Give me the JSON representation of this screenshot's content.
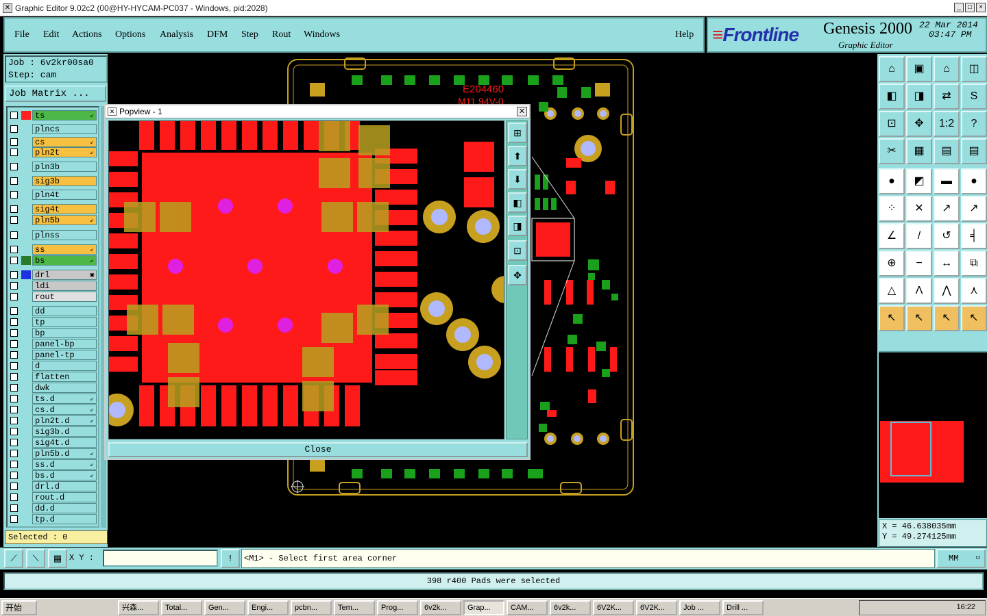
{
  "window": {
    "title": "Graphic Editor 9.02c2 (00@HY-HYCAM-PC037 - Windows, pid:2028)",
    "controls": [
      "_",
      "□",
      "×"
    ]
  },
  "menu": {
    "items": [
      "File",
      "Edit",
      "Actions",
      "Options",
      "Analysis",
      "DFM",
      "Step",
      "Rout",
      "Windows"
    ],
    "help": "Help"
  },
  "brand": {
    "logo": "Frontline",
    "product": "Genesis 2000",
    "subtitle": "Graphic Editor",
    "date": "22  Mar 2014",
    "time": "03:47 PM"
  },
  "job": {
    "job_line": "Job : 6v2kr00sa0",
    "step_line": "Step: cam",
    "matrix_label": "Job Matrix ..."
  },
  "layers": [
    {
      "name": "ts",
      "color": "#ff2020",
      "bg": "#4db848",
      "mark": "⇙"
    },
    {
      "name": "plncs",
      "color": "",
      "bg": "#98dede",
      "mark": ""
    },
    {
      "name": "cs",
      "color": "",
      "bg": "#f8c040",
      "mark": "⇙"
    },
    {
      "name": "pln2t",
      "color": "",
      "bg": "#f8c040",
      "mark": "⇙"
    },
    {
      "name": "pln3b",
      "color": "",
      "bg": "#98dede",
      "mark": ""
    },
    {
      "name": "sig3b",
      "color": "",
      "bg": "#f8c040",
      "mark": ""
    },
    {
      "name": "pln4t",
      "color": "",
      "bg": "#98dede",
      "mark": ""
    },
    {
      "name": "sig4t",
      "color": "",
      "bg": "#f8c040",
      "mark": ""
    },
    {
      "name": "pln5b",
      "color": "",
      "bg": "#f8c040",
      "mark": "⇙"
    },
    {
      "name": "plnss",
      "color": "",
      "bg": "#98dede",
      "mark": ""
    },
    {
      "name": "ss",
      "color": "",
      "bg": "#f8c040",
      "mark": "⇙"
    },
    {
      "name": "bs",
      "color": "#2a7a2a",
      "bg": "#4db848",
      "mark": "⇙"
    },
    {
      "name": "drl",
      "color": "#2030e0",
      "bg": "#c8c8c8",
      "mark": "▣"
    },
    {
      "name": "ldi",
      "color": "",
      "bg": "#c8c8c8",
      "mark": ""
    },
    {
      "name": "rout",
      "color": "",
      "bg": "#e0e0e0",
      "mark": ""
    },
    {
      "name": "dd",
      "color": "",
      "bg": "#98dede",
      "mark": ""
    },
    {
      "name": "tp",
      "color": "",
      "bg": "#98dede",
      "mark": ""
    },
    {
      "name": "bp",
      "color": "",
      "bg": "#98dede",
      "mark": ""
    },
    {
      "name": "panel-bp",
      "color": "",
      "bg": "#98dede",
      "mark": ""
    },
    {
      "name": "panel-tp",
      "color": "",
      "bg": "#98dede",
      "mark": ""
    },
    {
      "name": "d",
      "color": "",
      "bg": "#98dede",
      "mark": ""
    },
    {
      "name": "flatten",
      "color": "",
      "bg": "#98dede",
      "mark": ""
    },
    {
      "name": "dwk",
      "color": "",
      "bg": "#98dede",
      "mark": ""
    },
    {
      "name": "ts.d",
      "color": "",
      "bg": "#98dede",
      "mark": "⇙"
    },
    {
      "name": "cs.d",
      "color": "",
      "bg": "#98dede",
      "mark": "⇙"
    },
    {
      "name": "pln2t.d",
      "color": "",
      "bg": "#98dede",
      "mark": "⇙"
    },
    {
      "name": "sig3b.d",
      "color": "",
      "bg": "#98dede",
      "mark": ""
    },
    {
      "name": "sig4t.d",
      "color": "",
      "bg": "#98dede",
      "mark": ""
    },
    {
      "name": "pln5b.d",
      "color": "",
      "bg": "#98dede",
      "mark": "⇙"
    },
    {
      "name": "ss.d",
      "color": "",
      "bg": "#98dede",
      "mark": "⇙"
    },
    {
      "name": "bs.d",
      "color": "",
      "bg": "#98dede",
      "mark": "⇙"
    },
    {
      "name": "drl.d",
      "color": "",
      "bg": "#98dede",
      "mark": ""
    },
    {
      "name": "rout.d",
      "color": "",
      "bg": "#98dede",
      "mark": ""
    },
    {
      "name": "dd.d",
      "color": "",
      "bg": "#98dede",
      "mark": ""
    },
    {
      "name": "tp.d",
      "color": "",
      "bg": "#98dede",
      "mark": ""
    }
  ],
  "selected_label": "Selected : 0",
  "board": {
    "label_1": "E204460",
    "label_2": "M11 94V-0"
  },
  "popview": {
    "title": "Popview - 1",
    "close_label": "Close",
    "tools": [
      "zoom-fit-icon",
      "zoom-in-icon",
      "zoom-out-icon",
      "pan-left-icon",
      "pan-right-icon",
      "fit-screen-icon",
      "center-icon"
    ]
  },
  "right_tools": [
    "home-icon",
    "page-down-icon",
    "building-icon",
    "split-view-icon",
    "left-arrow-icon",
    "right-arrow-icon",
    "swap-icon",
    "s-curve-icon",
    "fit-all-icon",
    "center-view-icon",
    "scale-1-2-icon",
    "help-icon",
    "measure-icon",
    "grid-icon",
    "select-layers-icon",
    "select-layers-2-icon",
    "pad-icon",
    "line-color-icon",
    "ruler-icon",
    "circle-icon",
    "connect-icon",
    "cross-icon",
    "arrow-link-icon",
    "pointer-link-icon",
    "edit-line-icon",
    "slash-icon",
    "rotate-icon",
    "align-icon",
    "add-pad-icon",
    "line-icon",
    "dimension-icon",
    "group-icon",
    "triangle-icon",
    "peak-icon",
    "peak-up-icon",
    "peak-left-icon",
    "select-arrow-icon",
    "select-box-icon",
    "select-circle-icon",
    "select-path-icon"
  ],
  "right_tool_glyphs": [
    "⌂",
    "▣",
    "⌂",
    "◫",
    "◧",
    "◨",
    "⇄",
    "S",
    "⊡",
    "✥",
    "1:2",
    "?",
    "✂",
    "▦",
    "▤",
    "▤",
    "●",
    "◩",
    "▬",
    "●",
    "⁘",
    "✕",
    "↗",
    "↗",
    "∠",
    "/",
    "↺",
    "╡",
    "⊕",
    "−",
    "↔",
    "⧉",
    "△",
    "Λ",
    "⋀",
    "⋏",
    "↖",
    "↖",
    "↖",
    "↖"
  ],
  "coords": {
    "x_line": "X = 46.638035mm",
    "y_line": "Y = 49.274125mm"
  },
  "bottom": {
    "xy_label": "X Y :",
    "xy_value": "",
    "prompt": "<M1> - Select first area corner",
    "units": "MM",
    "bang": "!"
  },
  "status": "398 r400 Pads were selected",
  "taskbar": {
    "start": "开始",
    "items": [
      "兴森...",
      "Total...",
      "Gen...",
      "Engi...",
      "pcbn...",
      "Tem...",
      "Prog...",
      "6v2k...",
      "Grap...",
      "CAM...",
      "6v2k...",
      "6V2K...",
      "6V2K...",
      "Job ...",
      "Drill ..."
    ],
    "active_index": 8,
    "clock": "16:22"
  },
  "colors": {
    "panel": "#98dede",
    "copper": "#ff1a1a",
    "pad_green": "#1aa01a",
    "gold": "#c8a020"
  }
}
